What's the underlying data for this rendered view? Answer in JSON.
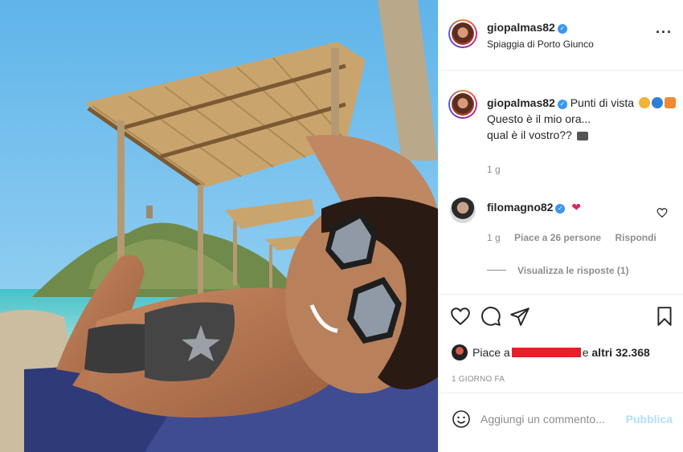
{
  "post": {
    "username": "giopalmas82",
    "location": "Spiaggia di Porto Giunco",
    "more_icon": "more-options-icon"
  },
  "caption": {
    "username": "giopalmas82",
    "line1": "Punti di vista",
    "line2": "Questo è il mio ora...",
    "line3": "qual è il vostro??",
    "time": "1 g"
  },
  "comment": {
    "username": "filomagno82",
    "emoji": "❤",
    "time": "1 g",
    "likes": "Piace a 26 persone",
    "reply": "Rispondi",
    "view_replies": "Visualizza le risposte (1)"
  },
  "likes": {
    "prefix": "Piace a",
    "suffix_connector": "e",
    "others": "altri 32.368"
  },
  "post_time": "1 GIORNO FA",
  "add_comment": {
    "placeholder": "Aggiungi un commento...",
    "publish": "Pubblica"
  },
  "colors": {
    "accent_blue": "#3897f0",
    "publish_disabled": "#b2dffc",
    "muted_text": "#8e8e8e",
    "sky": "#7ec6ef"
  }
}
